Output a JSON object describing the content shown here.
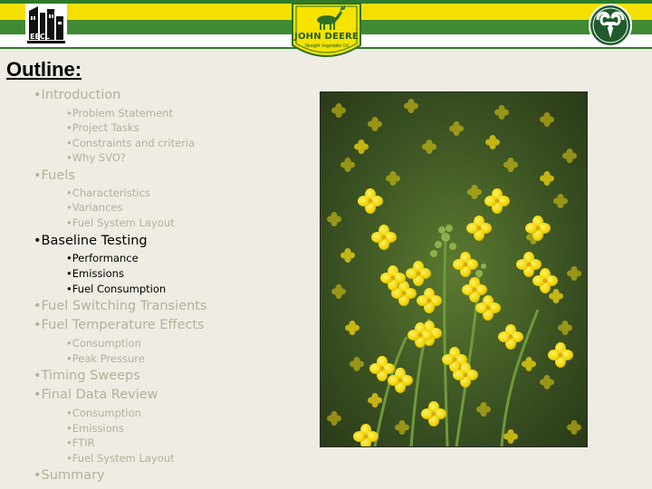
{
  "header": {
    "left_logo_text": "EECL",
    "center_logo_title": "JOHN DEERE",
    "center_logo_subtitle": "Straight Vegetable Oil",
    "colors": {
      "green": "#3f8a33",
      "yellow": "#f3e000",
      "white": "#ffffff"
    }
  },
  "slide": {
    "title": "Outline:",
    "outline": [
      {
        "level": 1,
        "text": "•Introduction",
        "state": "muted"
      },
      {
        "level": 2,
        "text": "•Problem Statement",
        "state": "muted"
      },
      {
        "level": 2,
        "text": "•Project Tasks",
        "state": "muted"
      },
      {
        "level": 2,
        "text": "•Constraints and criteria",
        "state": "muted"
      },
      {
        "level": 2,
        "text": "•Why SVO?",
        "state": "muted"
      },
      {
        "level": 1,
        "text": "•Fuels",
        "state": "muted"
      },
      {
        "level": 2,
        "text": "•Characteristics",
        "state": "muted"
      },
      {
        "level": 2,
        "text": "•Variances",
        "state": "muted"
      },
      {
        "level": 2,
        "text": "•Fuel System Layout",
        "state": "muted"
      },
      {
        "level": 1,
        "text": "•Baseline Testing",
        "state": "active"
      },
      {
        "level": 2,
        "text": "•Performance",
        "state": "active"
      },
      {
        "level": 2,
        "text": "•Emissions",
        "state": "active"
      },
      {
        "level": 2,
        "text": "•Fuel Consumption",
        "state": "active"
      },
      {
        "level": 1,
        "text": "•Fuel Switching Transients",
        "state": "muted"
      },
      {
        "level": 1,
        "text": "•Fuel Temperature Effects",
        "state": "muted"
      },
      {
        "level": 2,
        "text": "•Consumption",
        "state": "muted"
      },
      {
        "level": 2,
        "text": "•Peak Pressure",
        "state": "muted"
      },
      {
        "level": 1,
        "text": "•Timing Sweeps",
        "state": "muted"
      },
      {
        "level": 1,
        "text": "•Final Data Review",
        "state": "muted"
      },
      {
        "level": 2,
        "text": "•Consumption",
        "state": "muted"
      },
      {
        "level": 2,
        "text": "•Emissions",
        "state": "muted"
      },
      {
        "level": 2,
        "text": "•FTIR",
        "state": "muted"
      },
      {
        "level": 2,
        "text": "•Fuel System Layout",
        "state": "muted"
      },
      {
        "level": 1,
        "text": "•Summary",
        "state": "muted"
      }
    ],
    "colors": {
      "muted": "#b5b09a",
      "active": "#000000",
      "background": "#eeece3"
    }
  }
}
